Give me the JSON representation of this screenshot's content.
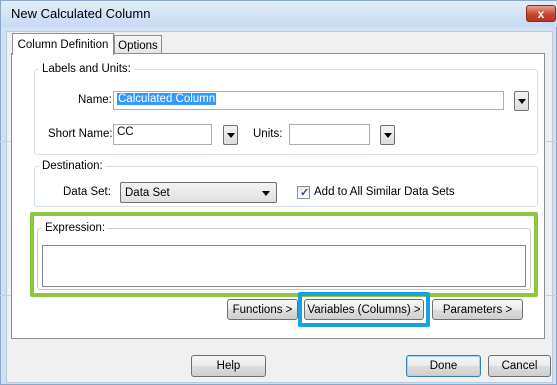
{
  "window": {
    "title": "New Calculated Column",
    "close_glyph": "x"
  },
  "tabs": [
    {
      "label": "Column Definition",
      "active": true
    },
    {
      "label": "Options",
      "active": false
    }
  ],
  "labels_units": {
    "legend": "Labels and Units:",
    "name_label": "Name:",
    "name_value": "Calculated Column",
    "short_name_label": "Short Name:",
    "short_name_value": "CC",
    "units_label": "Units:",
    "units_value": ""
  },
  "destination": {
    "legend": "Destination:",
    "data_set_label": "Data Set:",
    "data_set_value": "Data Set",
    "add_all_label": "Add to All Similar Data Sets",
    "add_all_checked": true
  },
  "expression": {
    "legend": "Expression:",
    "value": ""
  },
  "expression_buttons": {
    "functions": "Functions >",
    "variables": "Variables (Columns) >",
    "parameters": "Parameters >"
  },
  "footer": {
    "help": "Help",
    "done": "Done",
    "cancel": "Cancel"
  },
  "colors": {
    "highlight_green": "#8dc73f",
    "highlight_blue": "#1ba0e2",
    "selection": "#3399ff"
  }
}
